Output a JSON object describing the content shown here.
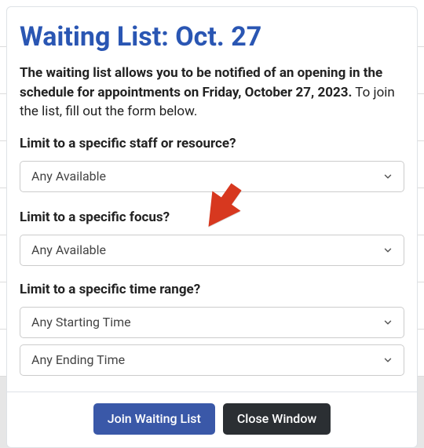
{
  "modal": {
    "title": "Waiting List: Oct. 27",
    "description_bold": "The waiting list allows you to be notified of an opening in the schedule for appointments on Friday, October 27, 2023.",
    "description_rest": " To join the list, fill out the form below.",
    "field_staff": {
      "label": "Limit to a specific staff or resource?",
      "value": "Any Available"
    },
    "field_focus": {
      "label": "Limit to a specific focus?",
      "value": "Any Available"
    },
    "field_time": {
      "label": "Limit to a specific time range?",
      "start_value": "Any Starting Time",
      "end_value": "Any Ending Time"
    },
    "buttons": {
      "join": "Join Waiting List",
      "close": "Close Window"
    }
  },
  "icons": {
    "chevron_color": "#555"
  },
  "annotation": {
    "arrow_fill": "#d7381f"
  }
}
